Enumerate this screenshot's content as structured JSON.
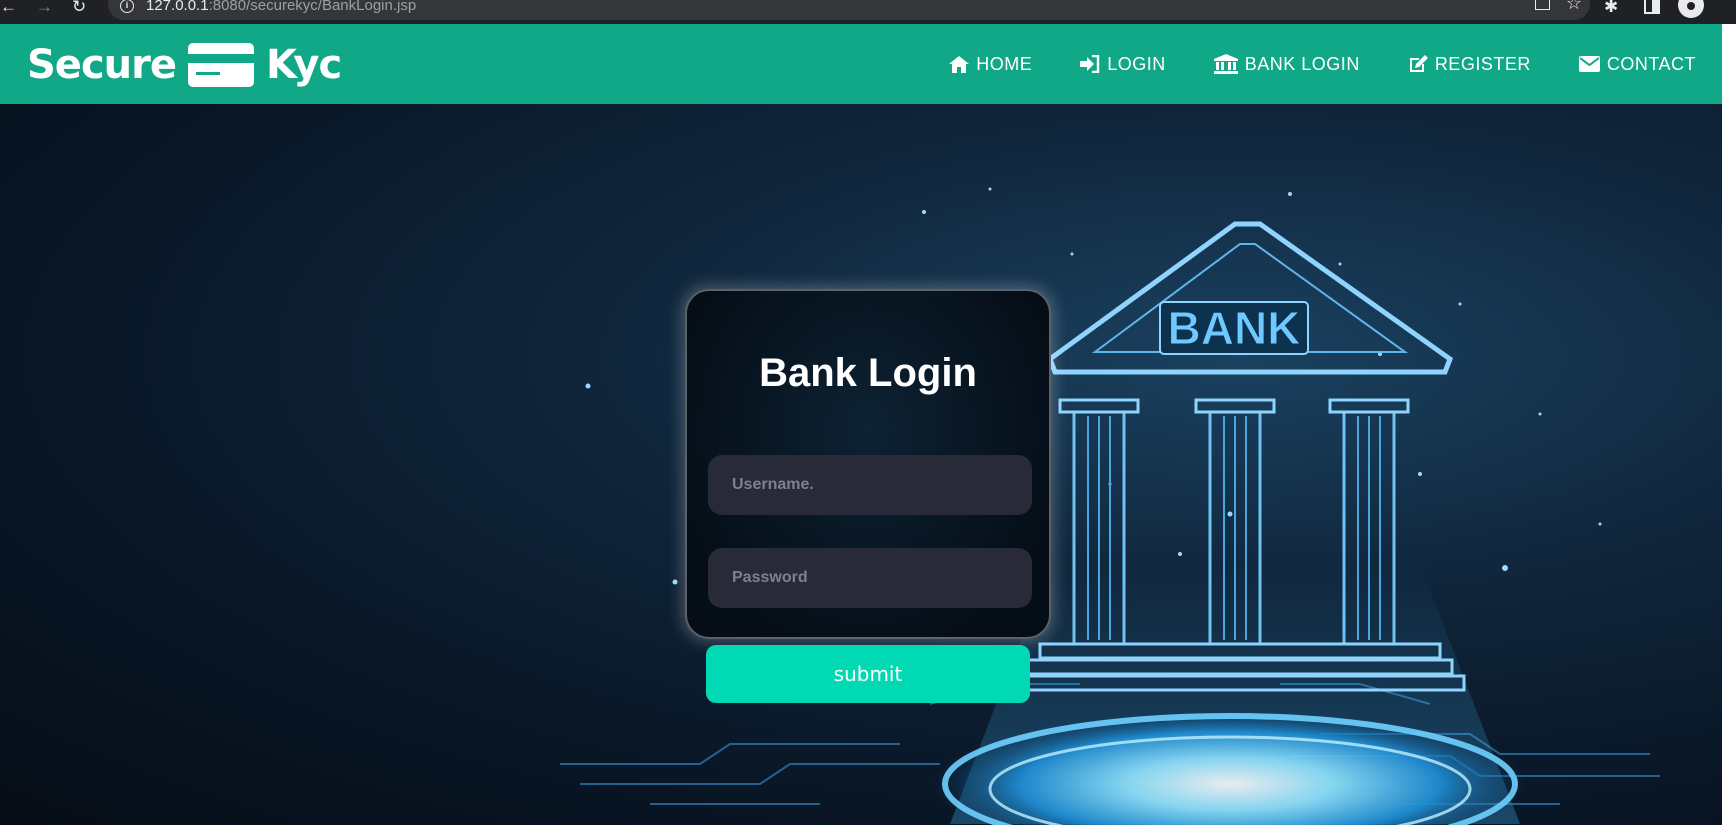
{
  "browser": {
    "url_host": "127.0.0.1",
    "url_rest": ":8080/securekyc/BankLogin.jsp"
  },
  "site": {
    "logo_left": "Secure",
    "logo_right": "Kyc",
    "brand_color": "#11a888"
  },
  "nav": [
    {
      "label": "HOME",
      "icon": "home-icon"
    },
    {
      "label": "LOGIN",
      "icon": "sign-in-icon"
    },
    {
      "label": "BANK LOGIN",
      "icon": "bank-icon"
    },
    {
      "label": "REGISTER",
      "icon": "edit-icon"
    },
    {
      "label": "CONTACT",
      "icon": "envelope-icon"
    }
  ],
  "login": {
    "title": "Bank Login",
    "username_placeholder": "Username.",
    "password_placeholder": "Password",
    "submit_label": "submit",
    "button_color": "#00d9b4"
  },
  "background": {
    "sign_text": "BANK"
  }
}
